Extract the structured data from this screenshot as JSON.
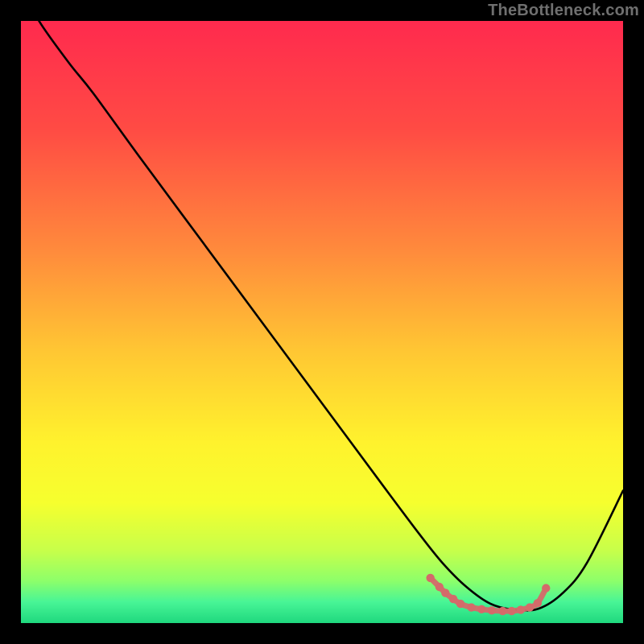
{
  "attribution": "TheBottleneck.com",
  "chart_data": {
    "type": "line",
    "title": "",
    "xlabel": "",
    "ylabel": "",
    "xlim": [
      0,
      100
    ],
    "ylim": [
      0,
      100
    ],
    "grid": false,
    "legend": false,
    "gradient_stops": [
      {
        "offset": 0.0,
        "color": "#ff2a4e"
      },
      {
        "offset": 0.18,
        "color": "#ff4b44"
      },
      {
        "offset": 0.38,
        "color": "#ff8a3c"
      },
      {
        "offset": 0.55,
        "color": "#ffc733"
      },
      {
        "offset": 0.7,
        "color": "#fff22d"
      },
      {
        "offset": 0.8,
        "color": "#f6ff2e"
      },
      {
        "offset": 0.88,
        "color": "#c7ff4a"
      },
      {
        "offset": 0.93,
        "color": "#8dff6a"
      },
      {
        "offset": 0.965,
        "color": "#48f596"
      },
      {
        "offset": 1.0,
        "color": "#1fd87e"
      }
    ],
    "series": [
      {
        "name": "bottleneck-curve",
        "color": "#000000",
        "x": [
          0,
          3,
          8,
          12,
          20,
          30,
          40,
          50,
          60,
          66,
          70,
          74,
          78,
          82,
          86,
          90,
          94,
          100
        ],
        "y": [
          106,
          100,
          93,
          88,
          77,
          63.5,
          50,
          36.5,
          23,
          15,
          10,
          6,
          3.2,
          2.2,
          2.4,
          5,
          10,
          22
        ]
      }
    ],
    "highlight": {
      "name": "optimal-range",
      "color": "#d46a6a",
      "points": [
        {
          "x": 68.0,
          "y": 7.5
        },
        {
          "x": 69.5,
          "y": 6.0
        },
        {
          "x": 70.5,
          "y": 5.0
        },
        {
          "x": 71.8,
          "y": 4.0
        },
        {
          "x": 73.0,
          "y": 3.2
        },
        {
          "x": 74.8,
          "y": 2.6
        },
        {
          "x": 76.5,
          "y": 2.3
        },
        {
          "x": 78.2,
          "y": 2.1
        },
        {
          "x": 80.0,
          "y": 2.0
        },
        {
          "x": 81.5,
          "y": 2.0
        },
        {
          "x": 83.0,
          "y": 2.2
        },
        {
          "x": 84.5,
          "y": 2.6
        },
        {
          "x": 85.8,
          "y": 3.3
        },
        {
          "x": 87.2,
          "y": 5.8
        }
      ]
    }
  }
}
